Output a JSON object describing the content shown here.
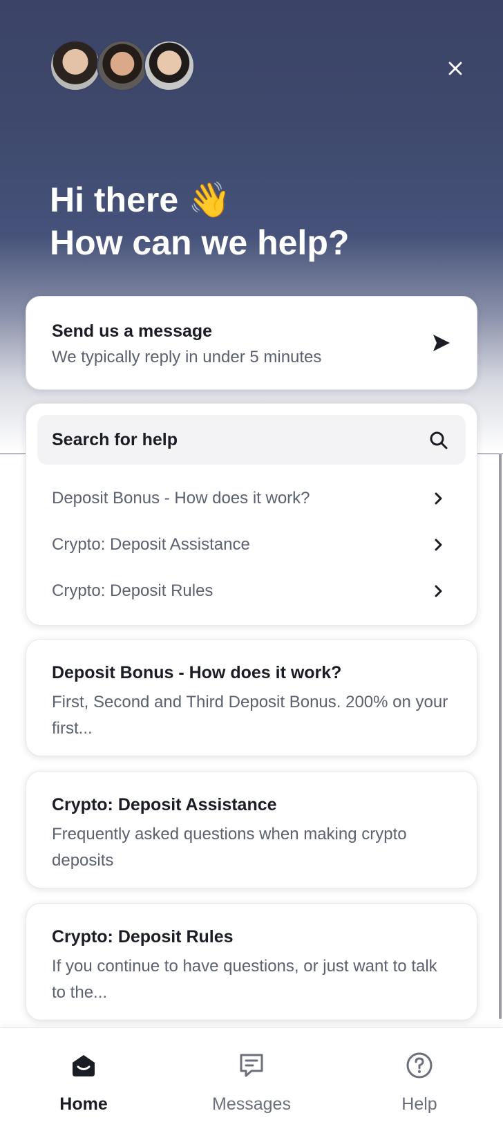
{
  "header": {
    "greeting_line1": "Hi  there 👋",
    "greeting_line2": "How can we help?",
    "avatars": [
      "avatar-woman",
      "avatar-man-1",
      "avatar-man-2"
    ],
    "close_icon": "close-icon"
  },
  "message_card": {
    "title": "Send us a message",
    "subtitle": "We typically reply in under 5 minutes",
    "icon": "send-icon"
  },
  "help_search": {
    "label": "Search for help",
    "icon": "search-icon",
    "items": [
      {
        "label": "Deposit Bonus - How does it work?"
      },
      {
        "label": "Crypto: Deposit Assistance"
      },
      {
        "label": "Crypto: Deposit Rules"
      }
    ]
  },
  "articles": [
    {
      "title": "Deposit Bonus - How does it work?",
      "description": "First, Second and Third Deposit Bonus. 200% on your first..."
    },
    {
      "title": "Crypto: Deposit Assistance",
      "description": "Frequently asked questions when making crypto deposits"
    },
    {
      "title": "Crypto: Deposit Rules",
      "description": "If you continue to have questions, or just want to talk to the..."
    }
  ],
  "bottom_nav": {
    "items": [
      {
        "label": "Home",
        "icon": "home-icon",
        "active": true
      },
      {
        "label": "Messages",
        "icon": "messages-icon",
        "active": false
      },
      {
        "label": "Help",
        "icon": "help-icon",
        "active": false
      }
    ]
  },
  "colors": {
    "header_bg": "#3b4466",
    "text_primary": "#1b1d24",
    "text_secondary": "#5c6170"
  }
}
